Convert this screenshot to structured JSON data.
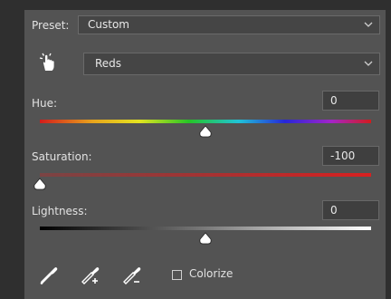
{
  "preset": {
    "label": "Preset:",
    "value": "Custom"
  },
  "channel": {
    "value": "Reds"
  },
  "hue": {
    "label": "Hue:",
    "value": "0",
    "fraction": 0.5
  },
  "saturation": {
    "label": "Saturation:",
    "value": "-100",
    "fraction": 0.0
  },
  "lightness": {
    "label": "Lightness:",
    "value": "0",
    "fraction": 0.5
  },
  "colorize": {
    "label": "Colorize",
    "checked": false
  },
  "icons": {
    "targeted_adjust": "hand-pointer-icon",
    "eyedropper": "eyedropper-icon",
    "eyedropper_add": "eyedropper-plus-icon",
    "eyedropper_subtract": "eyedropper-minus-icon",
    "chevron": "chevron-down-icon"
  },
  "colors": {
    "panel_bg": "#535353",
    "field_bg": "#454545",
    "saturation_track_start": "#7a4444",
    "saturation_track_end": "#d82020"
  }
}
